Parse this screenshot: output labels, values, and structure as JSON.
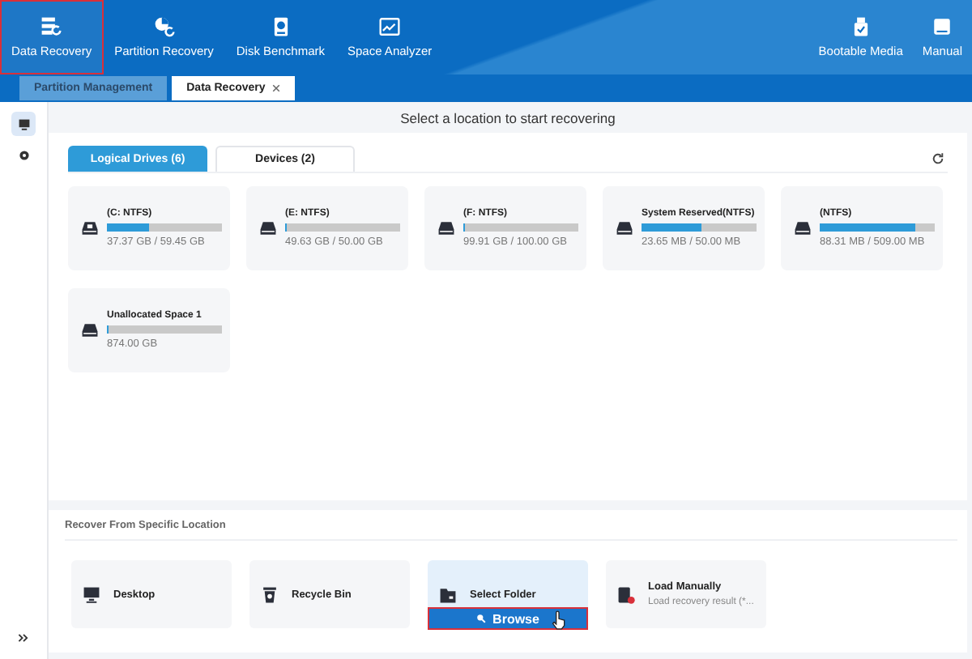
{
  "toolbar": {
    "items": [
      {
        "label": "Data Recovery",
        "selected": true
      },
      {
        "label": "Partition Recovery",
        "selected": false
      },
      {
        "label": "Disk Benchmark",
        "selected": false
      },
      {
        "label": "Space Analyzer",
        "selected": false
      }
    ],
    "right_items": [
      {
        "label": "Bootable Media"
      },
      {
        "label": "Manual"
      }
    ]
  },
  "tabs": [
    {
      "label": "Partition Management",
      "selected": false
    },
    {
      "label": "Data Recovery",
      "selected": true
    }
  ],
  "sidebar": {
    "items": [
      {
        "selected": true
      },
      {
        "selected": false
      }
    ]
  },
  "heading": "Select a location to start recovering",
  "drive_tabs": [
    {
      "label": "Logical Drives (6)",
      "selected": true
    },
    {
      "label": "Devices (2)",
      "selected": false
    }
  ],
  "drives": [
    {
      "name": "(C: NTFS)",
      "level": 0.37,
      "size": "37.37 GB / 59.45 GB"
    },
    {
      "name": "(E: NTFS)",
      "level": 0.01,
      "size": "49.63 GB / 50.00 GB"
    },
    {
      "name": "(F: NTFS)",
      "level": 0,
      "size": "99.91 GB / 100.00 GB"
    },
    {
      "name": "System Reserved(NTFS)",
      "level": 0.52,
      "size": "23.65 MB / 50.00 MB"
    },
    {
      "name": "(NTFS)",
      "level": 0.83,
      "size": "88.31 MB / 509.00 MB"
    },
    {
      "name": "Unallocated Space 1",
      "level": 0,
      "size": "874.00 GB"
    }
  ],
  "specific": {
    "title": "Recover From Specific Location",
    "locations": [
      {
        "kind": "desktop",
        "label": "Desktop"
      },
      {
        "kind": "recycle",
        "label": "Recycle Bin"
      },
      {
        "kind": "folder",
        "label": "Select Folder",
        "button": "Browse"
      },
      {
        "kind": "load",
        "label": "Load Manually",
        "subtitle": "Load recovery result (*..."
      }
    ]
  }
}
